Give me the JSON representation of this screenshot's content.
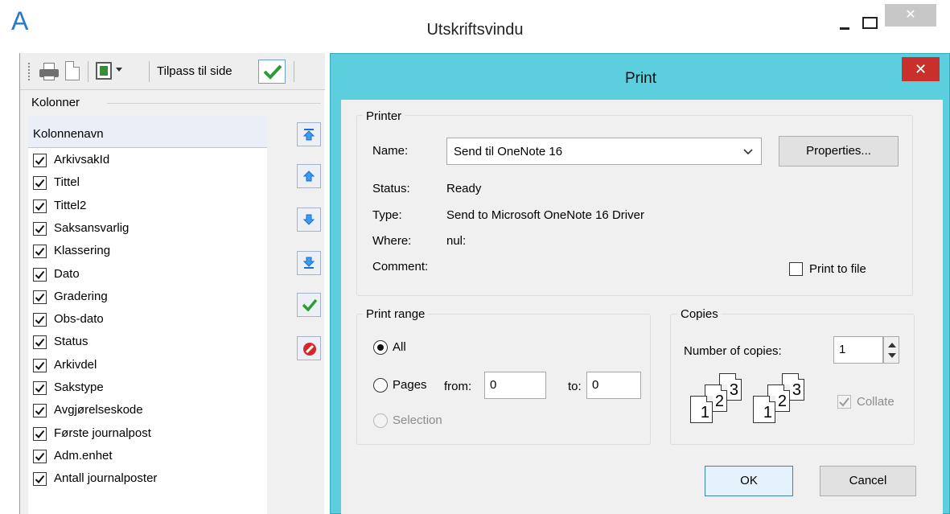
{
  "window": {
    "title": "Utskriftsvindu",
    "logo": "A",
    "close_glyph": "✕"
  },
  "toolbar": {
    "fit_to_page_label": "Tilpass til side",
    "icons": [
      "print-icon",
      "document-icon",
      "page-layout-icon",
      "checkmark-icon"
    ]
  },
  "columns_panel": {
    "group_label": "Kolonner",
    "header": "Kolonnenavn",
    "items": [
      {
        "label": "ArkivsakId",
        "checked": true
      },
      {
        "label": "Tittel",
        "checked": true
      },
      {
        "label": "Tittel2",
        "checked": true
      },
      {
        "label": "Saksansvarlig",
        "checked": true
      },
      {
        "label": "Klassering",
        "checked": true
      },
      {
        "label": "Dato",
        "checked": true
      },
      {
        "label": "Gradering",
        "checked": true
      },
      {
        "label": "Obs-dato",
        "checked": true
      },
      {
        "label": "Status",
        "checked": true
      },
      {
        "label": "Arkivdel",
        "checked": true
      },
      {
        "label": "Sakstype",
        "checked": true
      },
      {
        "label": "Avgjørelseskode",
        "checked": true
      },
      {
        "label": "Første journalpost",
        "checked": true
      },
      {
        "label": "Adm.enhet",
        "checked": true
      },
      {
        "label": "Antall journalposter",
        "checked": true
      }
    ],
    "side_buttons": [
      "move-to-top-icon",
      "move-up-icon",
      "move-down-icon",
      "move-to-bottom-icon",
      "confirm-icon",
      "cancel-icon"
    ]
  },
  "print_dialog": {
    "title": "Print",
    "close_glyph": "✕",
    "printer": {
      "group_label": "Printer",
      "name_label": "Name:",
      "name_value": "Send til OneNote 16",
      "properties_label": "Properties...",
      "status_label": "Status:",
      "status_value": "Ready",
      "type_label": "Type:",
      "type_value": "Send to Microsoft OneNote 16 Driver",
      "where_label": "Where:",
      "where_value": "nul:",
      "comment_label": "Comment:",
      "print_to_file_label": "Print to file"
    },
    "print_range": {
      "group_label": "Print range",
      "all_label": "All",
      "pages_label": "Pages",
      "from_label": "from:",
      "from_value": "0",
      "to_label": "to:",
      "to_value": "0",
      "selection_label": "Selection",
      "selected": "All"
    },
    "copies": {
      "group_label": "Copies",
      "number_label": "Number of copies:",
      "number_value": "1",
      "collate_label": "Collate",
      "collate_checked": true,
      "page_numbers": [
        "1",
        "2",
        "3"
      ]
    },
    "ok_label": "OK",
    "cancel_label": "Cancel"
  }
}
